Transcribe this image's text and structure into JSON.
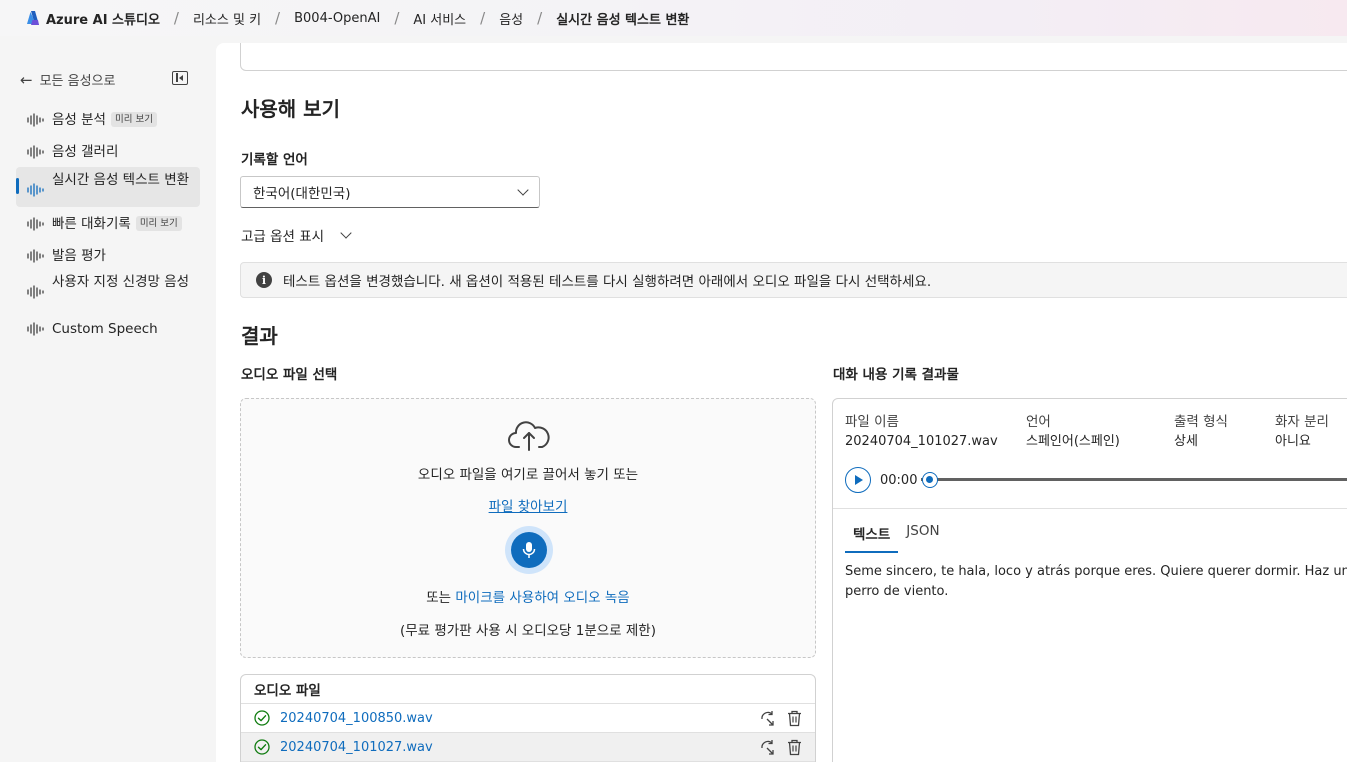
{
  "header": {
    "brand": "Azure AI 스튜디오",
    "crumbs": [
      "리소스 및 키",
      "B004-OpenAI",
      "AI 서비스",
      "음성"
    ],
    "current": "실시간 음성 텍스트 변환"
  },
  "sidebar": {
    "back_label": "모든 음성으로",
    "items": [
      {
        "label": "음성 분석",
        "badge": "미리 보기"
      },
      {
        "label": "음성 갤러리",
        "badge": ""
      },
      {
        "label": "실시간 음성 텍스트 변환",
        "badge": ""
      },
      {
        "label": "빠른 대화기록",
        "badge": "미리 보기"
      },
      {
        "label": "발음 평가",
        "badge": ""
      },
      {
        "label": "사용자 지정 신경망 음성",
        "badge": ""
      },
      {
        "label": "Custom Speech",
        "badge": ""
      }
    ]
  },
  "main": {
    "try_title": "사용해 보기",
    "language_label": "기록할 언어",
    "language_value": "한국어(대한민국)",
    "advanced_label": "고급 옵션 표시",
    "info_text": "테스트 옵션을 변경했습니다. 새 옵션이 적용된 테스트를 다시 실행하려면 아래에서 오디오 파일을 다시 선택하세요.",
    "results_title": "결과",
    "select_audio_label": "오디오 파일 선택",
    "transcript_label": "대화 내용 기록 결과물"
  },
  "dropzone": {
    "drag_text": "오디오 파일을 여기로 끌어서 놓기 또는",
    "browse_link": "파일 찾아보기",
    "or_text": "또는 ",
    "mic_link": "마이크를 사용하여 오디오 녹음",
    "limit_text": "(무료 평가판 사용 시 오디오당 1분으로 제한)"
  },
  "files": {
    "header": "오디오 파일",
    "rows": [
      {
        "name": "20240704_100850.wav",
        "selected": false
      },
      {
        "name": "20240704_101027.wav",
        "selected": true
      }
    ]
  },
  "transcript": {
    "meta": [
      {
        "key": "파일 이름",
        "value": "20240704_101027.wav"
      },
      {
        "key": "언어",
        "value": "스페인어(스페인)"
      },
      {
        "key": "출력 형식",
        "value": "상세"
      },
      {
        "key": "화자 분리",
        "value": "아니요"
      }
    ],
    "time": "00:00",
    "tabs": [
      "텍스트",
      "JSON"
    ],
    "active_tab": "텍스트",
    "line1": "Seme sincero, te hala, loco y atrás porque eres. Quiere querer dormir. Haz una cal",
    "line2": "perro de viento."
  },
  "colors": {
    "accent": "#0f6cbd",
    "success": "#107c10"
  }
}
